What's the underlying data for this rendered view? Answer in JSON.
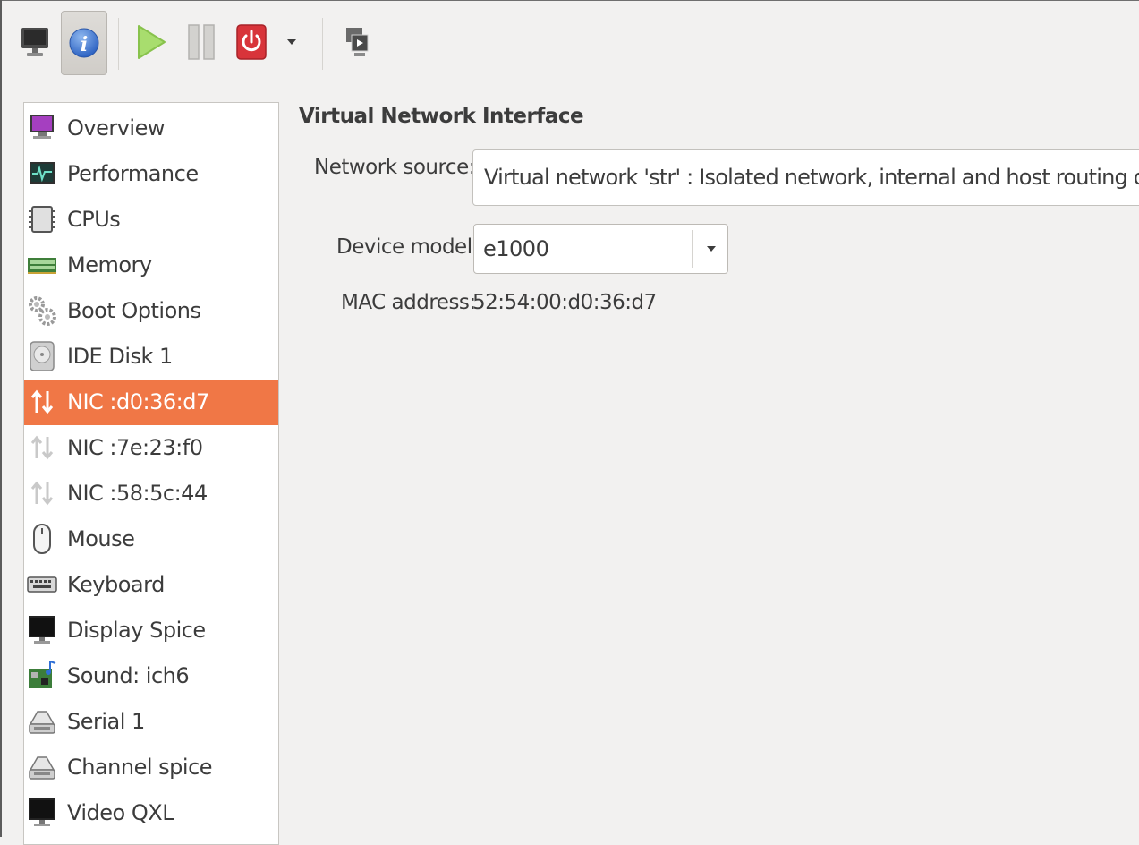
{
  "toolbar": {
    "items": [
      {
        "name": "console-button",
        "icon": "monitor-icon"
      },
      {
        "name": "details-button",
        "icon": "info-icon",
        "active": true
      },
      {
        "name": "run-button",
        "icon": "play-icon"
      },
      {
        "name": "pause-button",
        "icon": "pause-icon"
      },
      {
        "name": "shutdown-button",
        "icon": "power-icon"
      },
      {
        "name": "shutdown-menu-button",
        "icon": "dropdown-arrow-icon"
      },
      {
        "name": "fullscreen-button",
        "icon": "fullscreen-icon"
      }
    ]
  },
  "sidebar": {
    "items": [
      {
        "label": "Overview",
        "icon": "overview-icon"
      },
      {
        "label": "Performance",
        "icon": "performance-icon"
      },
      {
        "label": "CPUs",
        "icon": "cpu-icon"
      },
      {
        "label": "Memory",
        "icon": "memory-icon"
      },
      {
        "label": "Boot Options",
        "icon": "boot-options-icon"
      },
      {
        "label": "IDE Disk 1",
        "icon": "disk-icon"
      },
      {
        "label": "NIC :d0:36:d7",
        "icon": "network-icon",
        "selected": true
      },
      {
        "label": "NIC :7e:23:f0",
        "icon": "network-icon"
      },
      {
        "label": "NIC :58:5c:44",
        "icon": "network-icon"
      },
      {
        "label": "Mouse",
        "icon": "mouse-icon"
      },
      {
        "label": "Keyboard",
        "icon": "keyboard-icon"
      },
      {
        "label": "Display Spice",
        "icon": "display-icon"
      },
      {
        "label": "Sound: ich6",
        "icon": "sound-card-icon"
      },
      {
        "label": "Serial 1",
        "icon": "serial-icon"
      },
      {
        "label": "Channel spice",
        "icon": "channel-icon"
      },
      {
        "label": "Video QXL",
        "icon": "video-icon"
      }
    ]
  },
  "details": {
    "title": "Virtual Network Interface",
    "network_source_label": "Network source:",
    "network_source_value": "Virtual network 'str' : Isolated network, internal and host routing only",
    "device_model_label": "Device model:",
    "device_model_value": "e1000",
    "mac_address_label": "MAC address:",
    "mac_address_value": "52:54:00:d0:36:d7"
  },
  "colors": {
    "selection": "#f07746",
    "window_bg": "#f2f1f0",
    "run_green": "#8bd24a",
    "shutdown_red": "#d8343a"
  }
}
